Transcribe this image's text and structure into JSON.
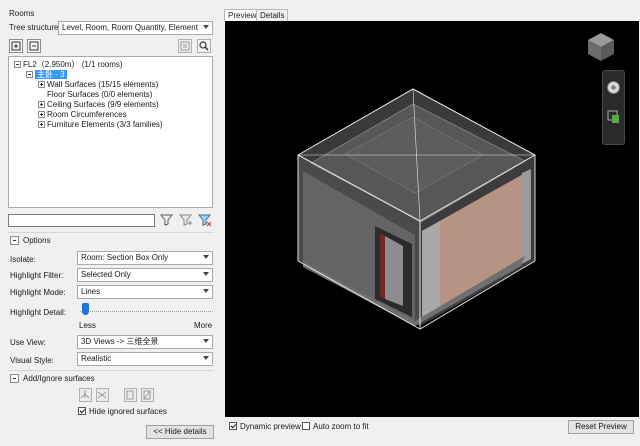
{
  "panel": {
    "title": "Rooms",
    "tree_structure_label": "Tree structure:",
    "tree_structure_value": "Level, Room, Room Quantity, Element"
  },
  "toolbar_icons": [
    "expand-all-icon",
    "collapse-all-icon",
    "export-icon",
    "search-icon"
  ],
  "tree": {
    "level": "FL2（2.950m）  (1/1 rooms)",
    "room": "主卧 - 3",
    "children": [
      "Wall Surfaces (15/15 elements)",
      "Floor Surfaces (0/0 elements)",
      "Ceiling Surfaces (9/9 elements)",
      "Room Circumferences",
      "Furniture Elements (3/3 families)"
    ]
  },
  "filter": {
    "search_value": ""
  },
  "options": {
    "header": "Options",
    "isolate_label": "Isolate:",
    "isolate_value": "Room: Section Box Only",
    "highlight_filter_label": "Highlight Filter:",
    "highlight_filter_value": "Selected Only",
    "highlight_mode_label": "Highlight Mode:",
    "highlight_mode_value": "Lines",
    "highlight_detail_label": "Highlight Detail:",
    "highlight_detail_level": 0.03,
    "less_label": "Less",
    "more_label": "More",
    "use_view_label": "Use View:",
    "use_view_value": "3D Views -> 三维全景",
    "visual_style_label": "Visual Style:",
    "visual_style_value": "Realistic"
  },
  "add_ignore": {
    "header": "Add/Ignore surfaces",
    "hide_ignored_label": "Hide ignored surfaces",
    "hide_ignored_checked": true
  },
  "hide_details_label": "<< Hide details",
  "tabs": {
    "preview": "Preview",
    "details": "Details"
  },
  "bottom": {
    "dynamic_preview_label": "Dynamic preview",
    "dynamic_preview_checked": true,
    "auto_zoom_label": "Auto zoom to fit",
    "auto_zoom_checked": false,
    "reset_preview_label": "Reset Preview"
  },
  "colors": {
    "selection": "#3399ff",
    "viewport_bg": "#000000",
    "wall_finish": "#b79384"
  }
}
